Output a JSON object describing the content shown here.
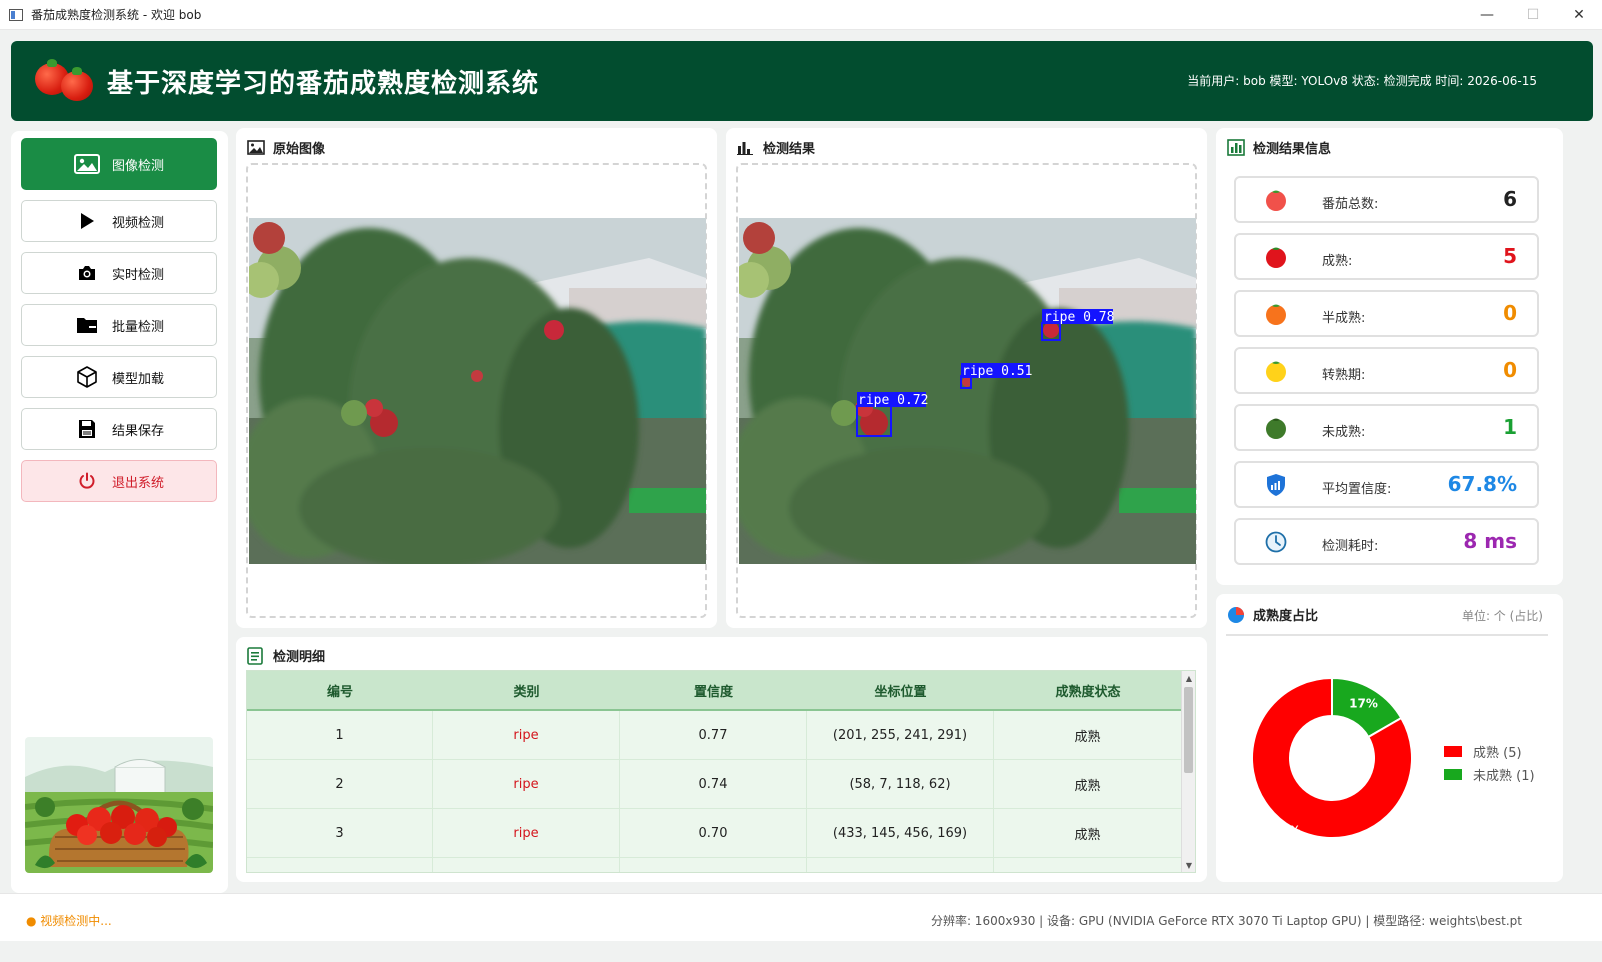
{
  "window": {
    "title": "番茄成熟度检测系统 - 欢迎 bob",
    "minimize": "—",
    "maximize": "☐",
    "close": "✕"
  },
  "header": {
    "title": "基于深度学习的番茄成熟度检测系统",
    "info": "当前用户: bob  模型: YOLOv8  状态: 检测完成  时间: 2026-06-15"
  },
  "sidebar": {
    "items": [
      {
        "label": "图像检测",
        "icon": "image-icon",
        "active": true
      },
      {
        "label": "视频检测",
        "icon": "play-icon"
      },
      {
        "label": "实时检测",
        "icon": "camera-icon"
      },
      {
        "label": "批量检测",
        "icon": "folder-icon"
      },
      {
        "label": "模型加载",
        "icon": "cube-icon"
      },
      {
        "label": "结果保存",
        "icon": "save-icon"
      },
      {
        "label": "退出系统",
        "icon": "power-icon",
        "exit": true
      }
    ]
  },
  "original": {
    "title": "原始图像"
  },
  "result": {
    "title": "检测结果",
    "boxes": [
      {
        "label": "ripe 0.78"
      },
      {
        "label": "ripe 0.51"
      },
      {
        "label": "ripe 0.72"
      }
    ]
  },
  "info_panel": {
    "title": "检测结果信息",
    "stats": [
      {
        "label": "番茄总数:",
        "value": "6",
        "color": "#222222",
        "icon": "tomato-red-icon"
      },
      {
        "label": "成熟:",
        "value": "5",
        "color": "#e0141c",
        "icon": "tomato-ripe-icon"
      },
      {
        "label": "半成熟:",
        "value": "0",
        "color": "#f08c00",
        "icon": "tomato-orange-icon"
      },
      {
        "label": "转熟期:",
        "value": "0",
        "color": "#f08c00",
        "icon": "tomato-yellow-icon"
      },
      {
        "label": "未成熟:",
        "value": "1",
        "color": "#1aa033",
        "icon": "tomato-green-icon"
      },
      {
        "label": "平均置信度:",
        "value": "67.8%",
        "color": "#1e88e5",
        "icon": "shield-chart-icon"
      },
      {
        "label": "检测耗时:",
        "value": "8 ms",
        "color": "#9c27b0",
        "icon": "clock-icon"
      }
    ]
  },
  "pie": {
    "title": "成熟度占比",
    "unit": "单位: 个 (占比)"
  },
  "chart_data": {
    "type": "pie",
    "categories": [
      "成熟",
      "未成熟"
    ],
    "values": [
      5,
      1
    ],
    "percent_labels": [
      "83%",
      "17%"
    ],
    "colors": [
      "#ff0000",
      "#18a81e"
    ],
    "legend": [
      "成熟 (5)",
      "未成熟 (1)"
    ],
    "legend_placement": "right"
  },
  "detail": {
    "title": "检测明细",
    "columns": [
      "编号",
      "类别",
      "置信度",
      "坐标位置",
      "成熟度状态"
    ],
    "rows": [
      [
        "1",
        "ripe",
        "0.77",
        "(201, 255, 241, 291)",
        "成熟"
      ],
      [
        "2",
        "ripe",
        "0.74",
        "(58, 7, 118, 62)",
        "成熟"
      ],
      [
        "3",
        "ripe",
        "0.70",
        "(433, 145, 456, 169)",
        "成熟"
      ]
    ]
  },
  "status": {
    "left": "● 视频检测中...",
    "right": "分辨率: 1600x930  |  设备: GPU (NVIDIA GeForce RTX 3070 Ti Laptop GPU)  |  模型路径: weights\\best.pt"
  }
}
